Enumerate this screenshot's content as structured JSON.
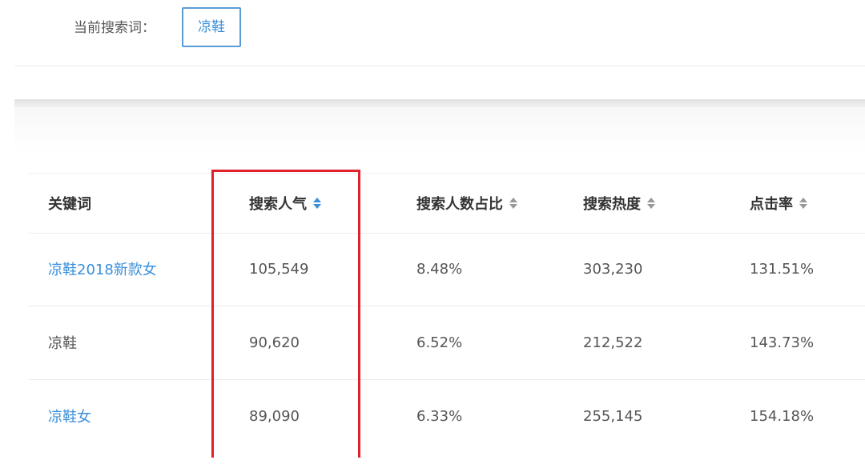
{
  "search": {
    "label": "当前搜索词：",
    "term": "凉鞋"
  },
  "table": {
    "headers": [
      "关键词",
      "搜索人气",
      "搜索人数占比",
      "搜索热度",
      "点击率"
    ],
    "rows": [
      {
        "keyword": "凉鞋2018新款女",
        "popularity": "105,549",
        "searcher_share": "8.48%",
        "heat": "303,230",
        "ctr": "131.51%"
      },
      {
        "keyword": "凉鞋",
        "popularity": "90,620",
        "searcher_share": "6.52%",
        "heat": "212,522",
        "ctr": "143.73%"
      },
      {
        "keyword": "凉鞋女",
        "popularity": "89,090",
        "searcher_share": "6.33%",
        "heat": "255,145",
        "ctr": "154.18%"
      }
    ]
  },
  "colors": {
    "link": "#3a8fd9",
    "active_sort": "#3a8fd9",
    "highlight": "#e0202a"
  },
  "icons": {
    "sort": "sort-updown-icon"
  }
}
